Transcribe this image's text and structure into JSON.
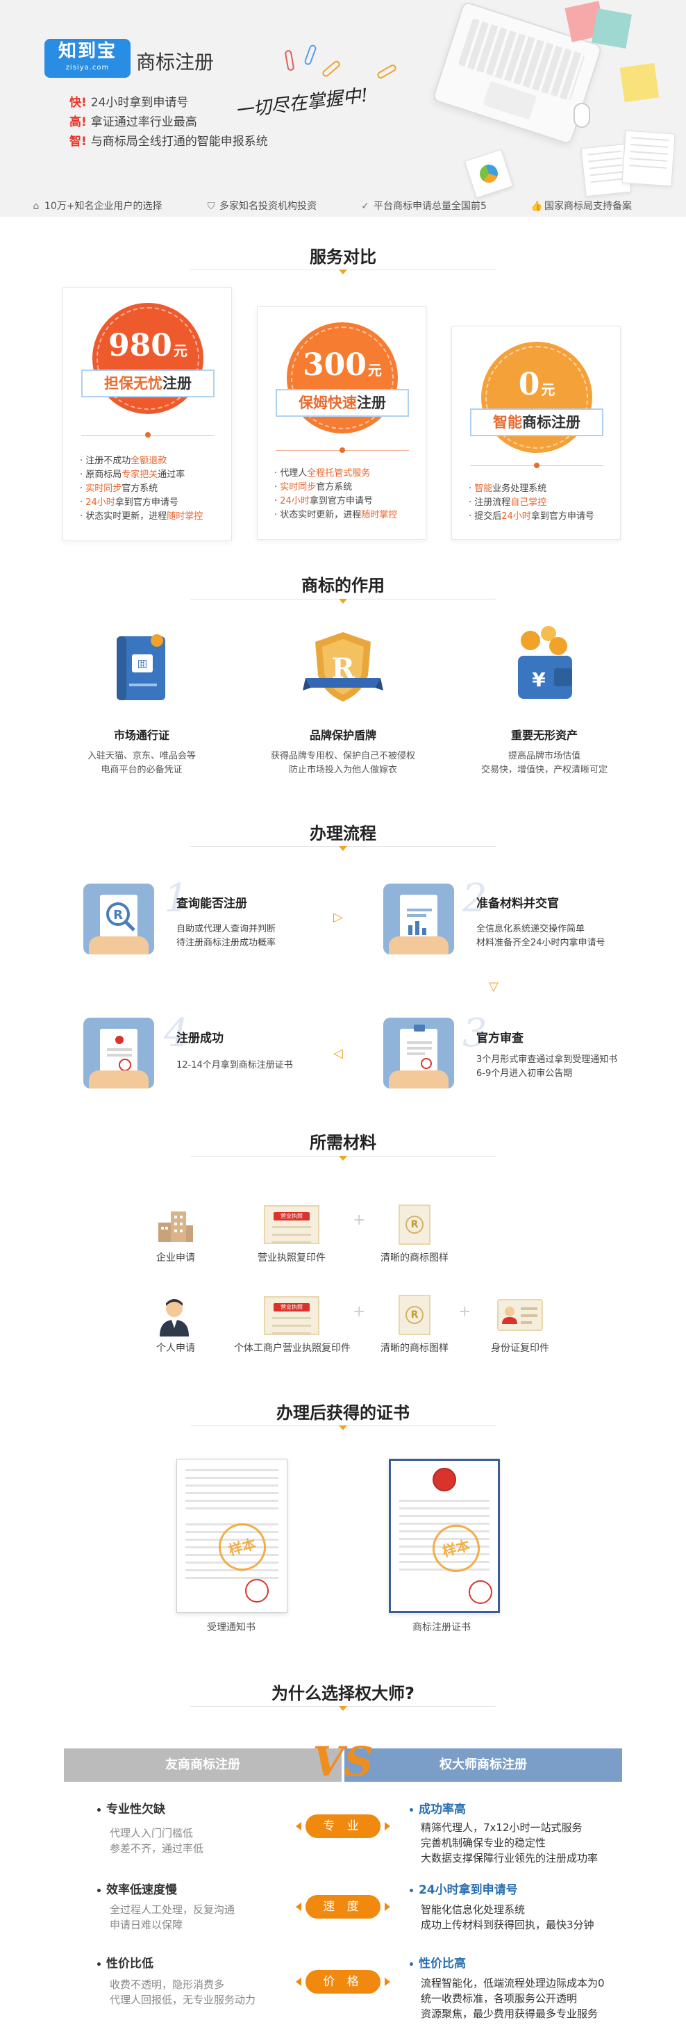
{
  "hero": {
    "logo_main": "知到宝",
    "logo_sub": "zisiya.com",
    "title": "商标注册",
    "lines": [
      {
        "key": "快!",
        "text": "24小时拿到申请号"
      },
      {
        "key": "高!",
        "text": "拿证通过率行业最高"
      },
      {
        "key": "智!",
        "text": "与商标局全线打通的智能申报系统"
      }
    ],
    "slogan": "一切尽在掌握中!",
    "stats": [
      {
        "icon": "home-icon",
        "glyph": "⌂",
        "text": "10万+知名企业用户的选择"
      },
      {
        "icon": "shield-icon",
        "glyph": "⛉",
        "text": "多家知名投资机构投资"
      },
      {
        "icon": "check-circle-icon",
        "glyph": "✓",
        "text": "平台商标申请总量全国前5"
      },
      {
        "icon": "thumbs-up-icon",
        "glyph": "👍",
        "text": "国家商标局支持备案"
      }
    ]
  },
  "sections": {
    "service": "服务对比",
    "role": "商标的作用",
    "process": "办理流程",
    "materials": "所需材料",
    "certificates": "办理后获得的证书",
    "why": "为什么选择权大师?"
  },
  "service_cards": [
    {
      "price": "980",
      "unit": "元",
      "color": "#ee5a2c",
      "ribbon_hl": "担保无忧",
      "ribbon_rest": "注册",
      "items": [
        [
          "· 注册不成功",
          "全额退款",
          ""
        ],
        [
          "· 原商标局",
          "专家把关",
          "通过率"
        ],
        [
          "· ",
          "实时同步",
          "官方系统"
        ],
        [
          "· ",
          "24小时",
          "拿到官方申请号"
        ],
        [
          "· 状态实时更新，进程",
          "随时掌控",
          ""
        ]
      ]
    },
    {
      "price": "300",
      "unit": "元",
      "color": "#f57c30",
      "ribbon_hl": "保姆快速",
      "ribbon_rest": "注册",
      "items": [
        [
          "· 代理人",
          "全程托管式服务",
          ""
        ],
        [
          "· ",
          "实时同步",
          "官方系统"
        ],
        [
          "· ",
          "24小时",
          "拿到官方申请号"
        ],
        [
          "· 状态实时更新，进程",
          "随时掌控",
          ""
        ]
      ]
    },
    {
      "price": "0",
      "unit": "元",
      "color": "#f5a13a",
      "ribbon_hl": "智能",
      "ribbon_rest": "商标注册",
      "items": [
        [
          "· ",
          "智能",
          "业务处理系统"
        ],
        [
          "· 注册流程",
          "自己掌控",
          ""
        ],
        [
          "· 提交后",
          "24小时",
          "拿到官方申请号"
        ]
      ]
    }
  ],
  "roles": [
    {
      "icon": "passbook-icon",
      "title": "市场通行证",
      "lines": [
        "入驻天猫、京东、唯品会等",
        "电商平台的必备凭证"
      ]
    },
    {
      "icon": "shield-r-icon",
      "title": "品牌保护盾牌",
      "lines": [
        "获得品牌专用权、保护自己不被侵权",
        "防止市场投入为他人做嫁衣"
      ]
    },
    {
      "icon": "wallet-icon",
      "title": "重要无形资产",
      "lines": [
        "提高品牌市场估值",
        "交易快，增值快，产权清晰可定"
      ]
    }
  ],
  "process": [
    {
      "num": "1",
      "title": "查询能否注册",
      "lines": [
        "自助或代理人查询并判断",
        "待注册商标注册成功概率"
      ]
    },
    {
      "num": "2",
      "title": "准备材料并交官",
      "lines": [
        "全信息化系统递交操作简单",
        "材料准备齐全24小时内拿申请号"
      ]
    },
    {
      "num": "3",
      "title": "官方审查",
      "lines": [
        "3个月形式审查通过拿到受理通知书",
        "6-9个月进入初审公告期"
      ]
    },
    {
      "num": "4",
      "title": "注册成功",
      "lines": [
        "12-14个月拿到商标注册证书"
      ]
    }
  ],
  "materials": {
    "row1": [
      {
        "icon": "building-icon",
        "label": "企业申请"
      },
      {
        "icon": "license-icon",
        "label": "营业执照复印件",
        "badge": "营业执照"
      },
      {
        "icon": "trademark-image-icon",
        "label": "清晰的商标图样",
        "mark": "R"
      }
    ],
    "row2": [
      {
        "icon": "person-icon",
        "label": "个人申请"
      },
      {
        "icon": "license-icon",
        "label": "个体工商户营业执照复印件",
        "badge": "营业执照"
      },
      {
        "icon": "trademark-image-icon",
        "label": "清晰的商标图样",
        "mark": "R"
      },
      {
        "icon": "id-card-icon",
        "label": "身份证复印件"
      }
    ],
    "plus": "+"
  },
  "certificates": [
    {
      "label": "受理通知书",
      "stamp": "样本"
    },
    {
      "label": "商标注册证书",
      "stamp": "样本"
    }
  ],
  "compare": {
    "left_header": "友商商标注册",
    "right_header": "权大师商标注册",
    "vs": "VS",
    "rows": [
      {
        "pill": "专 业",
        "left_title": "专业性欠缺",
        "left_lines": [
          "代理人入门门槛低",
          "参差不齐，通过率低"
        ],
        "right_title": "成功率高",
        "right_lines": [
          "精筛代理人，7x12小时一站式服务",
          "完善机制确保专业的稳定性",
          "大数据支撑保障行业领先的注册成功率"
        ]
      },
      {
        "pill": "速 度",
        "left_title": "效率低速度慢",
        "left_lines": [
          "全过程人工处理，反复沟通",
          "申请日难以保障"
        ],
        "right_title": "24小时拿到申请号",
        "right_lines": [
          "智能化信息化处理系统",
          "成功上传材料到获得回执，最快3分钟"
        ]
      },
      {
        "pill": "价 格",
        "left_title": "性价比低",
        "left_lines": [
          "收费不透明，隐形消费多",
          "代理人回报低，无专业服务动力"
        ],
        "right_title": "性价比高",
        "right_lines": [
          "流程智能化，低端流程处理边际成本为0",
          "统一收费标准，各项服务公开透明",
          "资源聚焦，最少费用获得最多专业服务"
        ]
      }
    ]
  },
  "colors": {
    "accent": "#f0a229",
    "red": "#e8352a",
    "orange": "#f0890e",
    "blue": "#2a8de4",
    "grey_bar": "#bbbbbb",
    "blue_bar": "#7b9ec8"
  }
}
